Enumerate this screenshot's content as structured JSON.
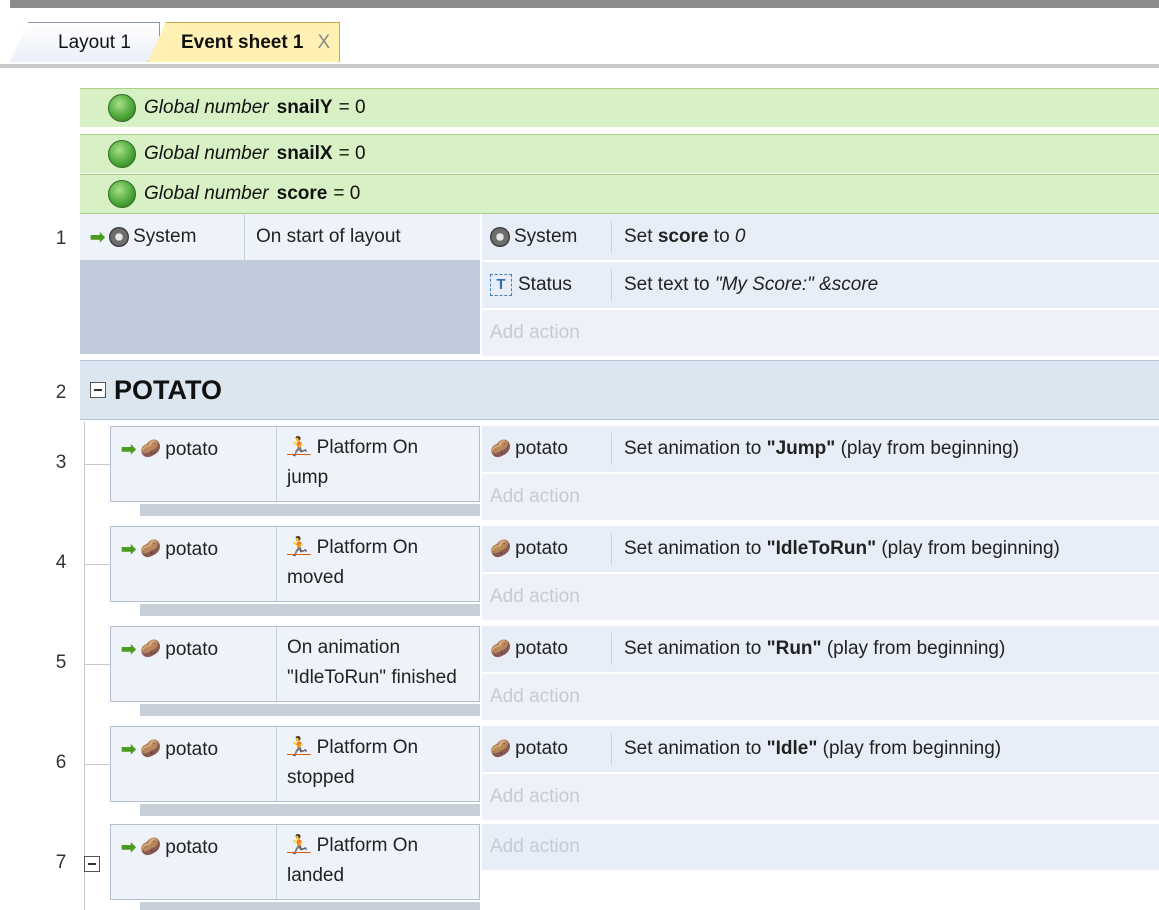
{
  "tabs": [
    {
      "label": "Layout 1",
      "active": false
    },
    {
      "label": "Event sheet 1",
      "active": true,
      "close": "X"
    }
  ],
  "globals": [
    {
      "keyword": "Global number",
      "name": "snailY",
      "value": "= 0"
    },
    {
      "keyword": "Global number",
      "name": "snailX",
      "value": "= 0"
    },
    {
      "keyword": "Global number",
      "name": "score",
      "value": "= 0"
    }
  ],
  "events": {
    "e1": {
      "num": "1",
      "cond_obj": "System",
      "cond_text": "On start of layout",
      "actions": [
        {
          "obj": "System",
          "pre": "Set ",
          "bold": "score",
          "post": " to ",
          "ital": "0"
        },
        {
          "obj": "Status",
          "pre": "Set text to ",
          "ital": "\"My Score:\"  &score"
        }
      ],
      "add_action": "Add action"
    },
    "group": {
      "num": "2",
      "name": "POTATO"
    },
    "e3": {
      "num": "3",
      "cond_obj": "potato",
      "cond_text": "Platform On jump",
      "cond_line1": "Platform On",
      "cond_line2": "jump",
      "act_obj": "potato",
      "act_pre": "Set animation to ",
      "act_bold": "\"Jump\"",
      "act_post": " (play from beginning)",
      "add_action": "Add action"
    },
    "e4": {
      "num": "4",
      "cond_obj": "potato",
      "cond_line1": "Platform On",
      "cond_line2": "moved",
      "act_obj": "potato",
      "act_pre": "Set animation to ",
      "act_bold": "\"IdleToRun\"",
      "act_post": " (play from beginning)",
      "add_action": "Add action"
    },
    "e5": {
      "num": "5",
      "cond_obj": "potato",
      "cond_line1": "On animation",
      "cond_line2": "\"IdleToRun\" finished",
      "act_obj": "potato",
      "act_pre": "Set animation to ",
      "act_bold": "\"Run\"",
      "act_post": " (play from beginning)",
      "add_action": "Add action"
    },
    "e6": {
      "num": "6",
      "cond_obj": "potato",
      "cond_line1": "Platform On",
      "cond_line2": "stopped",
      "act_obj": "potato",
      "act_pre": "Set animation to ",
      "act_bold": "\"Idle\"",
      "act_post": " (play from beginning)",
      "add_action": "Add action"
    },
    "e7": {
      "num": "7",
      "cond_obj": "potato",
      "cond_line1": "Platform On",
      "cond_line2": "landed",
      "add_action": "Add action"
    }
  },
  "colors": {
    "global_bg": "#d8f1c4",
    "event_bg": "#e8eef7",
    "group_bg": "#dce6f1",
    "active_tab": "#fff0b4"
  }
}
